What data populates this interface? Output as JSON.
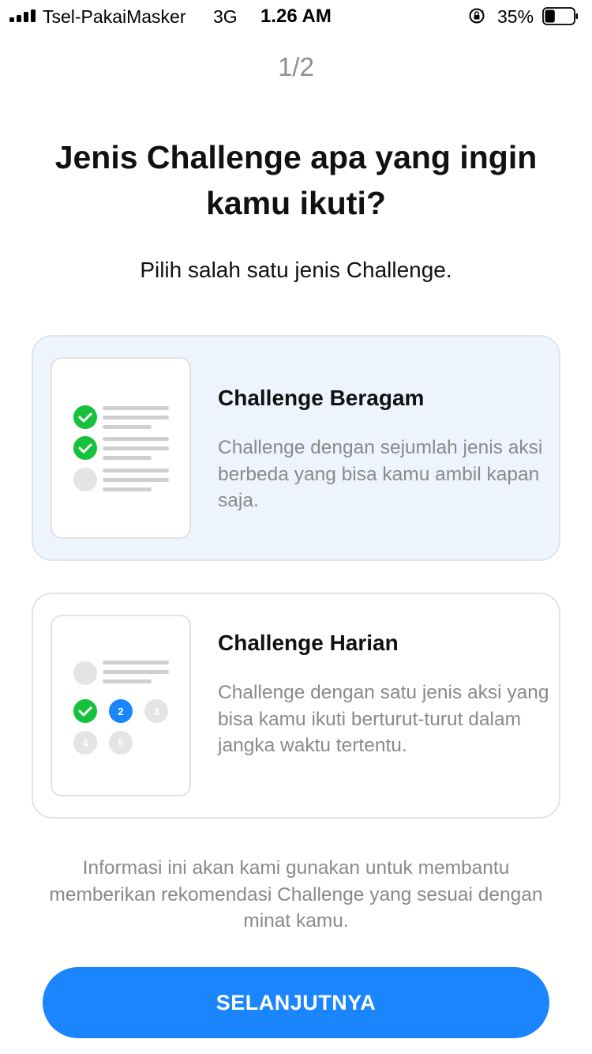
{
  "status_bar": {
    "carrier": "Tsel-PakaiMasker",
    "network": "3G",
    "time": "1.26 AM",
    "battery_percent": "35%",
    "battery_level": 0.35,
    "icons": [
      "signal-icon",
      "rotation-lock-icon",
      "battery-icon"
    ]
  },
  "step_indicator": "1/2",
  "title": "Jenis Challenge apa yang ingin kamu ikuti?",
  "subtitle": "Pilih salah satu jenis Challenge.",
  "options": [
    {
      "title": "Challenge Beragam",
      "description": "Challenge dengan sejumlah jenis aksi berbeda yang bisa kamu ambil kapan saja.",
      "selected": true
    },
    {
      "title": "Challenge Harian",
      "description": "Challenge dengan satu jenis aksi yang bisa kamu ikuti berturut-turut dalam jangka waktu tertentu.",
      "selected": false,
      "day_badges": [
        "2",
        "3",
        "4",
        "5"
      ]
    }
  ],
  "info_text": "Informasi ini akan kami gunakan untuk membantu memberikan rekomendasi Challenge yang sesuai dengan minat kamu.",
  "cta_label": "SELANJUTNYA",
  "colors": {
    "primary": "#1a85fd",
    "check_green": "#16c23c",
    "selected_card_bg": "#eef4fe",
    "muted_text": "#8a8a8a"
  }
}
